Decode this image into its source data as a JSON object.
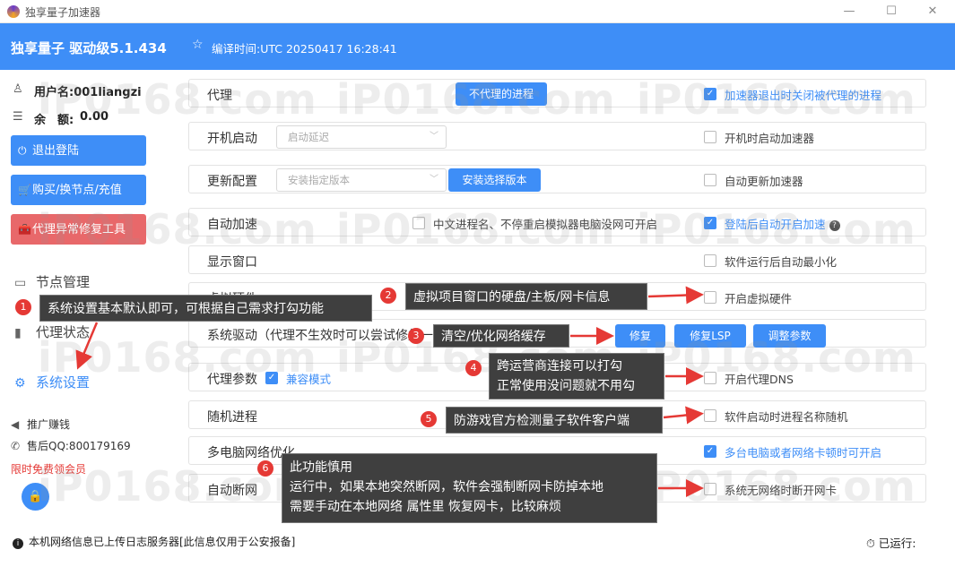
{
  "window": {
    "title": "独享量子加速器",
    "controls": [
      "—",
      "☐",
      "✕"
    ]
  },
  "header": {
    "brand": "独享量子 驱动级5.1.434",
    "build_time": "编译时间:UTC 20250417 16:28:41"
  },
  "sidebar": {
    "username": "用户名:001liangzi",
    "balance_label": "余　额:",
    "balance_value": "0.00",
    "buttons": {
      "logout": "退出登陆",
      "buy": "购买/换节点/充值",
      "repair": "代理异常修复工具"
    },
    "nav": {
      "nodes": "节点管理",
      "proxy_status": "代理状态",
      "settings": "系统设置"
    },
    "footer": {
      "promo": "推广赚钱",
      "support": "售后QQ:800179169",
      "free_vip": "限时免费领会员"
    }
  },
  "settings": {
    "rows": [
      {
        "label": "代理"
      },
      {
        "label": "开机启动"
      },
      {
        "label": "更新配置"
      },
      {
        "label": "自动加速"
      },
      {
        "label": "显示窗口"
      },
      {
        "label": "虚拟硬件"
      },
      {
        "label": "系统驱动（代理不生效时可以尝试修复一下）"
      },
      {
        "label": "代理参数"
      },
      {
        "label": "随机进程"
      },
      {
        "label": "多电脑网络优化"
      },
      {
        "label": "自动断网"
      }
    ],
    "proxy": {
      "button": "不代理的进程",
      "option": "加速器退出时关闭被代理的进程",
      "option_checked": true
    },
    "startup": {
      "select_placeholder": "启动延迟",
      "option": "开机时启动加速器",
      "option_checked": false
    },
    "update": {
      "select_placeholder": "安装指定版本",
      "button": "安装选择版本",
      "option": "自动更新加速器",
      "option_checked": false
    },
    "auto_accel": {
      "option1": "中文进程名、不停重启模拟器电脑没网可开启",
      "option1_checked": false,
      "option2": "登陆后自动开启加速",
      "option2_checked": true,
      "help": "?"
    },
    "window": {
      "option": "软件运行后自动最小化",
      "option_checked": false
    },
    "virtual_hw": {
      "option": "开启虚拟硬件",
      "option_checked": false
    },
    "driver": {
      "buttons": [
        "修复",
        "修复LSP",
        "调整参数"
      ]
    },
    "proxy_params": {
      "compat": "兼容模式",
      "compat_checked": true,
      "option": "开启代理DNS",
      "option_checked": false
    },
    "random_proc": {
      "option": "软件启动时进程名称随机",
      "option_checked": false
    },
    "multi_pc": {
      "option": "多台电脑或者网络卡顿时可开启",
      "option_checked": true
    },
    "auto_disconnect": {
      "option": "系统无网络时断开网卡",
      "option_checked": false
    }
  },
  "annotations": {
    "a1": {
      "num": "1",
      "text": "系统设置基本默认即可，可根据自己需求打勾功能"
    },
    "a2": {
      "num": "2",
      "text": "虚拟项目窗口的硬盘/主板/网卡信息"
    },
    "a3": {
      "num": "3",
      "text": "清空/优化网络缓存"
    },
    "a4": {
      "num": "4",
      "line1": "跨运营商连接可以打勾",
      "line2": "正常使用没问题就不用勾"
    },
    "a5": {
      "num": "5",
      "text": "防游戏官方检测量子软件客户端"
    },
    "a6": {
      "num": "6",
      "line1": "此功能慎用",
      "line2": "运行中，如果本地突然断网，软件会强制断网卡防掉本地",
      "line3": "需要手动在本地网络 属性里 恢复网卡，比较麻烦"
    },
    "arrow_color": "#e53935"
  },
  "watermark": "iP0168.com",
  "footer": {
    "info": "本机网络信息已上传日志服务器[此信息仅用于公安报备]",
    "running": "已运行:"
  }
}
